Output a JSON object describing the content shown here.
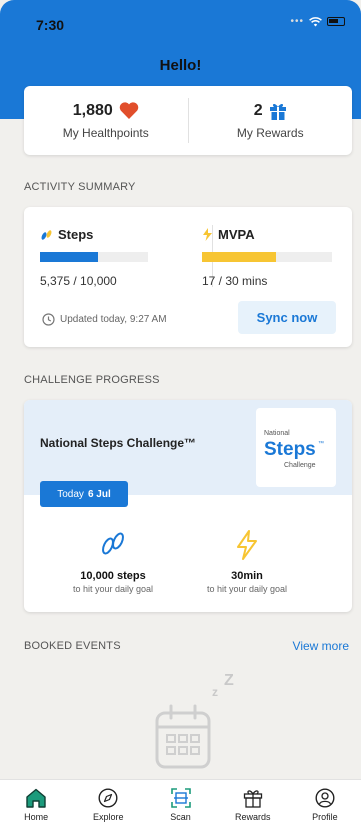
{
  "status_bar": {
    "time": "7:30",
    "dots": "•••"
  },
  "header": {
    "greeting": "Hello!"
  },
  "points": {
    "healthpoints_value": "1,880",
    "healthpoints_label": "My Healthpoints",
    "rewards_value": "2",
    "rewards_label": "My Rewards"
  },
  "activity": {
    "section_title": "ACTIVITY SUMMARY",
    "steps": {
      "title": "Steps",
      "value": "5,375 / 10,000",
      "progress": 0.5375,
      "color": "#1a78d6"
    },
    "mvpa": {
      "title": "MVPA",
      "value": "17 / 30 mins",
      "progress": 0.57,
      "color": "#f7c533"
    },
    "updated": "Updated today, 9:27 AM",
    "sync_label": "Sync now"
  },
  "challenge": {
    "section_title": "CHALLENGE PROGRESS",
    "name": "National Steps Challenge™",
    "logo": {
      "line1": "National",
      "line2": "Steps",
      "tm": "™",
      "line3": "Challenge"
    },
    "today_prefix": "Today",
    "today_date": "6 Jul",
    "goals": [
      {
        "main": "10,000 steps",
        "sub": "to hit your daily goal"
      },
      {
        "main": "30min",
        "sub": "to hit your daily goal"
      }
    ]
  },
  "booked_events": {
    "section_title": "BOOKED EVENTS",
    "view_more": "View more",
    "sleep_letters": [
      "z",
      "Z"
    ]
  },
  "nav": [
    {
      "label": "Home",
      "icon": "home-icon",
      "active": true
    },
    {
      "label": "Explore",
      "icon": "compass-icon"
    },
    {
      "label": "Scan",
      "icon": "scan-icon"
    },
    {
      "label": "Rewards",
      "icon": "gift-icon"
    },
    {
      "label": "Profile",
      "icon": "profile-icon"
    }
  ],
  "colors": {
    "brand_blue": "#1a78d6",
    "heart_red": "#e14e2b",
    "mvpa_yellow": "#f7c533",
    "home_green": "#1c9b7c"
  }
}
